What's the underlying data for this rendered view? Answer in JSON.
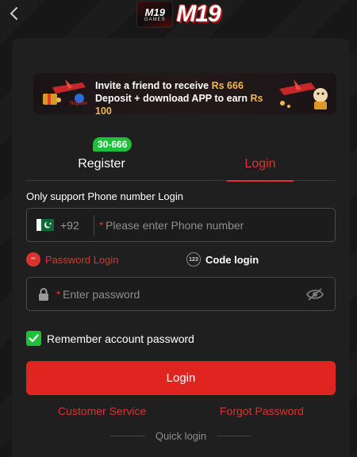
{
  "header": {
    "logo_badge_top": "M19",
    "logo_badge_bottom": "GAMES",
    "logo_text": "M19"
  },
  "banner": {
    "line1_prefix": "Invite a friend to receive ",
    "line1_amount": "Rs 666",
    "line2_prefix": "Deposit + download APP to earn ",
    "line2_amount": "Rs 100",
    "tiny_label": "Register"
  },
  "tabs": [
    {
      "label": "Register",
      "active": false
    },
    {
      "label": "Login",
      "active": true
    }
  ],
  "register_badge": "30-666",
  "login_hint": "Only support Phone number Login",
  "phone": {
    "country_code": "+92",
    "required_mark": "*",
    "placeholder": "Please enter Phone number"
  },
  "login_modes": {
    "password": {
      "label": "Password Login",
      "icon_text": "**"
    },
    "code": {
      "label": "Code login",
      "icon_text": "123"
    }
  },
  "password": {
    "required_mark": "*",
    "placeholder": "Enter password"
  },
  "remember": {
    "label": "Remember account password",
    "checked": true
  },
  "login_button": "Login",
  "links": {
    "customer_service": "Customer Service",
    "forgot_password": "Forgot Password"
  },
  "quick_login": "Quick login",
  "colors": {
    "accent": "#e0241f",
    "success": "#1fbf3a",
    "background": "#171717",
    "card": "#1f1f1f"
  }
}
